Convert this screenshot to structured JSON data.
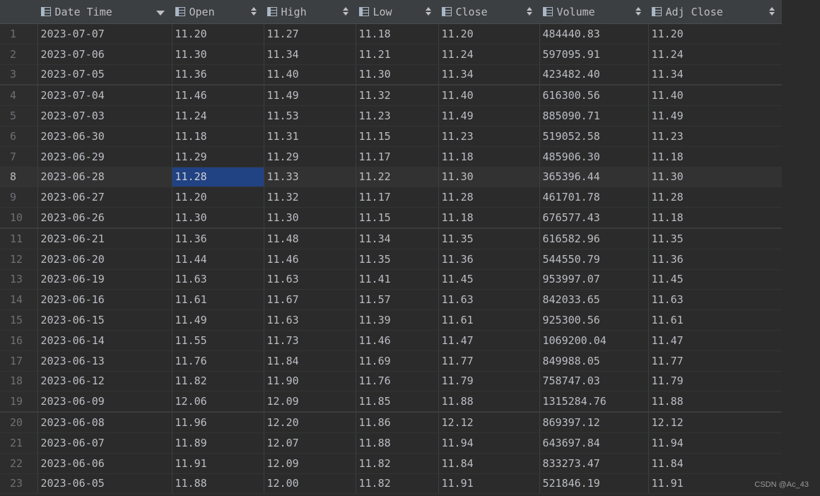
{
  "table": {
    "columns": [
      {
        "label": "Date Time",
        "sort": "desc"
      },
      {
        "label": "Open",
        "sort": "both"
      },
      {
        "label": "High",
        "sort": "both"
      },
      {
        "label": "Low",
        "sort": "both"
      },
      {
        "label": "Close",
        "sort": "both"
      },
      {
        "label": "Volume",
        "sort": "both"
      },
      {
        "label": "Adj Close",
        "sort": "both"
      }
    ],
    "selected_row": 8,
    "selected_column": "Open",
    "rows": [
      {
        "n": "1",
        "cells": [
          "2023-07-07",
          "11.20",
          "11.27",
          "11.18",
          "11.20",
          "484440.83",
          "11.20"
        ]
      },
      {
        "n": "2",
        "cells": [
          "2023-07-06",
          "11.30",
          "11.34",
          "11.21",
          "11.24",
          "597095.91",
          "11.24"
        ]
      },
      {
        "n": "3",
        "cells": [
          "2023-07-05",
          "11.36",
          "11.40",
          "11.30",
          "11.34",
          "423482.40",
          "11.34"
        ]
      },
      {
        "n": "4",
        "cells": [
          "2023-07-04",
          "11.46",
          "11.49",
          "11.32",
          "11.40",
          "616300.56",
          "11.40"
        ]
      },
      {
        "n": "5",
        "cells": [
          "2023-07-03",
          "11.24",
          "11.53",
          "11.23",
          "11.49",
          "885090.71",
          "11.49"
        ]
      },
      {
        "n": "6",
        "cells": [
          "2023-06-30",
          "11.18",
          "11.31",
          "11.15",
          "11.23",
          "519052.58",
          "11.23"
        ]
      },
      {
        "n": "7",
        "cells": [
          "2023-06-29",
          "11.29",
          "11.29",
          "11.17",
          "11.18",
          "485906.30",
          "11.18"
        ]
      },
      {
        "n": "8",
        "cells": [
          "2023-06-28",
          "11.28",
          "11.33",
          "11.22",
          "11.30",
          "365396.44",
          "11.30"
        ]
      },
      {
        "n": "9",
        "cells": [
          "2023-06-27",
          "11.20",
          "11.32",
          "11.17",
          "11.28",
          "461701.78",
          "11.28"
        ]
      },
      {
        "n": "10",
        "cells": [
          "2023-06-26",
          "11.30",
          "11.30",
          "11.15",
          "11.18",
          "676577.43",
          "11.18"
        ]
      },
      {
        "n": "11",
        "cells": [
          "2023-06-21",
          "11.36",
          "11.48",
          "11.34",
          "11.35",
          "616582.96",
          "11.35"
        ]
      },
      {
        "n": "12",
        "cells": [
          "2023-06-20",
          "11.44",
          "11.46",
          "11.35",
          "11.36",
          "544550.79",
          "11.36"
        ]
      },
      {
        "n": "13",
        "cells": [
          "2023-06-19",
          "11.63",
          "11.63",
          "11.41",
          "11.45",
          "953997.07",
          "11.45"
        ]
      },
      {
        "n": "14",
        "cells": [
          "2023-06-16",
          "11.61",
          "11.67",
          "11.57",
          "11.63",
          "842033.65",
          "11.63"
        ]
      },
      {
        "n": "15",
        "cells": [
          "2023-06-15",
          "11.49",
          "11.63",
          "11.39",
          "11.61",
          "925300.56",
          "11.61"
        ]
      },
      {
        "n": "16",
        "cells": [
          "2023-06-14",
          "11.55",
          "11.73",
          "11.46",
          "11.47",
          "1069200.04",
          "11.47"
        ]
      },
      {
        "n": "17",
        "cells": [
          "2023-06-13",
          "11.76",
          "11.84",
          "11.69",
          "11.77",
          "849988.05",
          "11.77"
        ]
      },
      {
        "n": "18",
        "cells": [
          "2023-06-12",
          "11.82",
          "11.90",
          "11.76",
          "11.79",
          "758747.03",
          "11.79"
        ]
      },
      {
        "n": "19",
        "cells": [
          "2023-06-09",
          "12.06",
          "12.09",
          "11.85",
          "11.88",
          "1315284.76",
          "11.88"
        ]
      },
      {
        "n": "20",
        "cells": [
          "2023-06-08",
          "11.96",
          "12.20",
          "11.86",
          "12.12",
          "869397.12",
          "12.12"
        ]
      },
      {
        "n": "21",
        "cells": [
          "2023-06-07",
          "11.89",
          "12.07",
          "11.88",
          "11.94",
          "643697.84",
          "11.94"
        ]
      },
      {
        "n": "22",
        "cells": [
          "2023-06-06",
          "11.91",
          "12.09",
          "11.82",
          "11.84",
          "833273.47",
          "11.84"
        ]
      },
      {
        "n": "23",
        "cells": [
          "2023-06-05",
          "11.88",
          "12.00",
          "11.82",
          "11.91",
          "521846.19",
          "11.91"
        ]
      }
    ]
  },
  "icons": {
    "column_icon": "table-column-icon",
    "sort_desc": "sort-desc-icon",
    "sort_both": "sort-icon"
  },
  "colors": {
    "background": "#2b2b2b",
    "header": "#3c3f41",
    "selection": "#214283",
    "text": "#bcbec4",
    "row_number": "#6e7075"
  },
  "watermark": "CSDN @Ac_43"
}
